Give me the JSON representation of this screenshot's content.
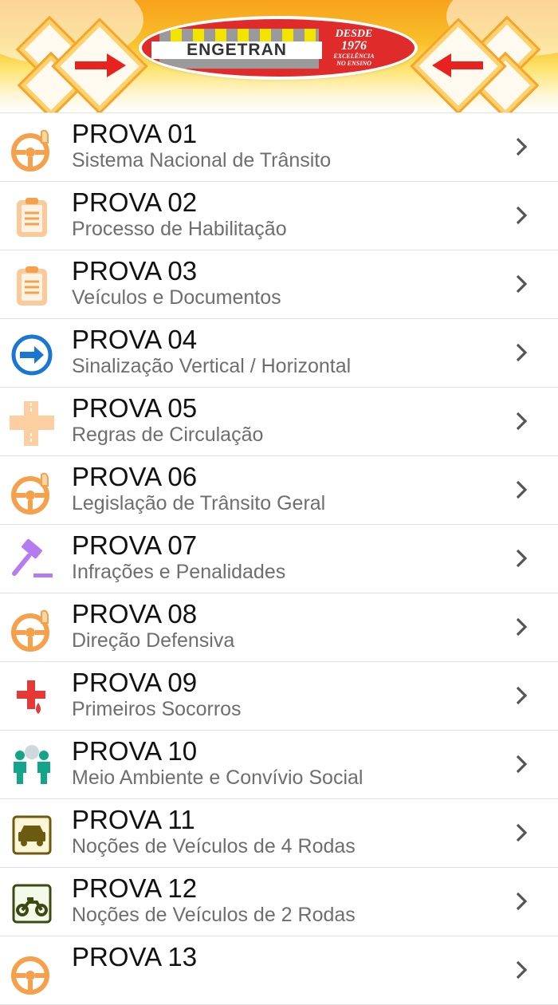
{
  "header": {
    "brand": "ENGETRAN",
    "stamp_line1": "DESDE",
    "stamp_line2": "1976",
    "stamp_line3": "EXCELÊNCIA",
    "stamp_line4": "NO ENSINO",
    "left_arrow_icon": "arrow-right-icon",
    "right_arrow_icon": "arrow-left-icon"
  },
  "items": [
    {
      "title": "PROVA 01",
      "subtitle": "Sistema Nacional de Trânsito",
      "icon": "steering-wheel-icon"
    },
    {
      "title": "PROVA 02",
      "subtitle": "Processo de Habilitação",
      "icon": "clipboard-icon"
    },
    {
      "title": "PROVA 03",
      "subtitle": "Veículos e Documentos",
      "icon": "clipboard-icon"
    },
    {
      "title": "PROVA 04",
      "subtitle": "Sinalização Vertical / Horizontal",
      "icon": "sign-arrow-icon"
    },
    {
      "title": "PROVA 05",
      "subtitle": "Regras de Circulação",
      "icon": "crossroad-icon"
    },
    {
      "title": "PROVA 06",
      "subtitle": "Legislação de Trânsito Geral",
      "icon": "steering-wheel-icon"
    },
    {
      "title": "PROVA 07",
      "subtitle": "Infrações e Penalidades",
      "icon": "gavel-icon"
    },
    {
      "title": "PROVA 08",
      "subtitle": "Direção Defensiva",
      "icon": "steering-wheel-icon"
    },
    {
      "title": "PROVA 09",
      "subtitle": "Primeiros Socorros",
      "icon": "first-aid-icon"
    },
    {
      "title": "PROVA 10",
      "subtitle": "Meio Ambiente e Convívio Social",
      "icon": "people-icon"
    },
    {
      "title": "PROVA 11",
      "subtitle": "Noções de Veículos de 4 Rodas",
      "icon": "car-icon"
    },
    {
      "title": "PROVA 12",
      "subtitle": "Noções de Veículos de 2 Rodas",
      "icon": "motorcycle-icon"
    },
    {
      "title": "PROVA 13",
      "subtitle": "",
      "icon": "steering-wheel-icon"
    }
  ],
  "colors": {
    "orange": "#f5a04a",
    "blue": "#1976d2",
    "purple": "#b57bf0",
    "red": "#e53935",
    "green": "#12a58a",
    "olive": "#6b5a10",
    "accent_red": "#e02b2b"
  }
}
